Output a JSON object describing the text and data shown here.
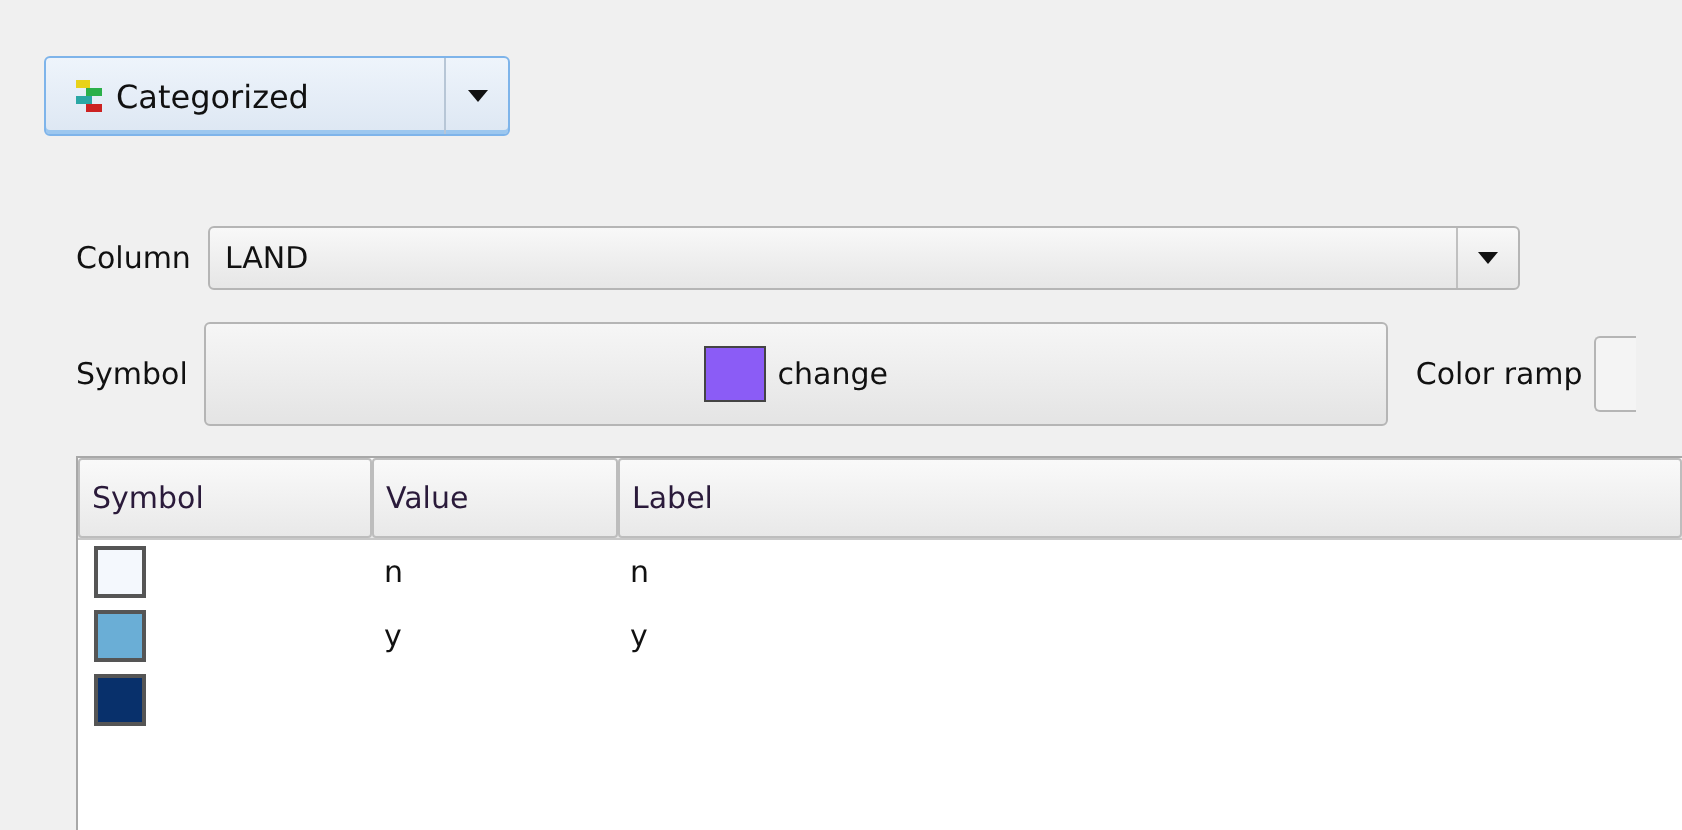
{
  "renderer": {
    "label": "Categorized"
  },
  "column": {
    "label": "Column",
    "value": "LAND"
  },
  "symbol": {
    "label": "Symbol",
    "color": "#8b5cf6",
    "name": "change"
  },
  "color_ramp": {
    "label": "Color ramp"
  },
  "table": {
    "columns": [
      "Symbol",
      "Value",
      "Label"
    ],
    "rows": [
      {
        "color": "#f4f8fd",
        "value": "n",
        "label": "n"
      },
      {
        "color": "#6aaed6",
        "value": "y",
        "label": "y"
      },
      {
        "color": "#08306b"
      }
    ]
  }
}
